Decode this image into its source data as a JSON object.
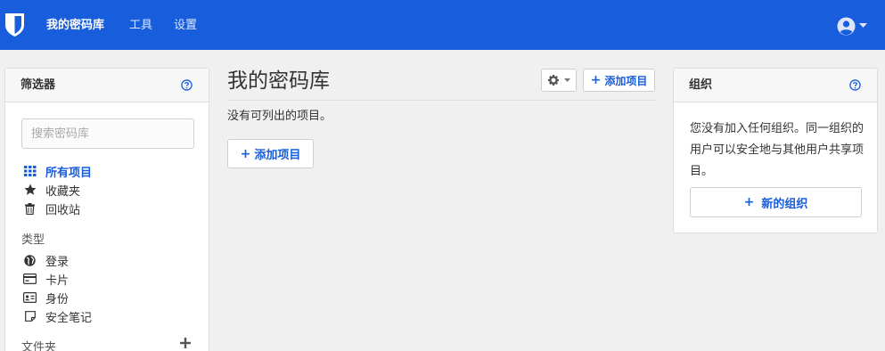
{
  "navbar": {
    "brand_icon": "shield-icon",
    "links": [
      {
        "label": "我的密码库",
        "active": true
      },
      {
        "label": "工具",
        "active": false
      },
      {
        "label": "设置",
        "active": false
      }
    ],
    "user_icon": "user-circle-icon",
    "caret_icon": "caret-down-icon",
    "colors": {
      "bg": "#175ddc"
    }
  },
  "filter": {
    "title": "筛选器",
    "help_icon": "question-circle-icon",
    "search_placeholder": "搜索密码库",
    "items": [
      {
        "label": "所有项目",
        "icon": "grid-icon",
        "active": true
      },
      {
        "label": "收藏夹",
        "icon": "star-icon",
        "active": false
      },
      {
        "label": "回收站",
        "icon": "trash-icon",
        "active": false
      }
    ],
    "types_label": "类型",
    "types": [
      {
        "label": "登录",
        "icon": "globe-icon"
      },
      {
        "label": "卡片",
        "icon": "credit-card-icon"
      },
      {
        "label": "身份",
        "icon": "id-card-icon"
      },
      {
        "label": "安全笔记",
        "icon": "sticky-note-icon"
      }
    ],
    "folders_label": "文件夹",
    "add_folder_icon": "plus-icon"
  },
  "main": {
    "title": "我的密码库",
    "gear_icon": "gear-icon",
    "add_item_label": "添加项目",
    "empty_text": "没有可列出的项目。"
  },
  "org": {
    "title": "组织",
    "help_icon": "question-circle-icon",
    "description": "您没有加入任何组织。同一组织的用户可以安全地与其他用户共享项目。",
    "new_org_label": "新的组织"
  }
}
